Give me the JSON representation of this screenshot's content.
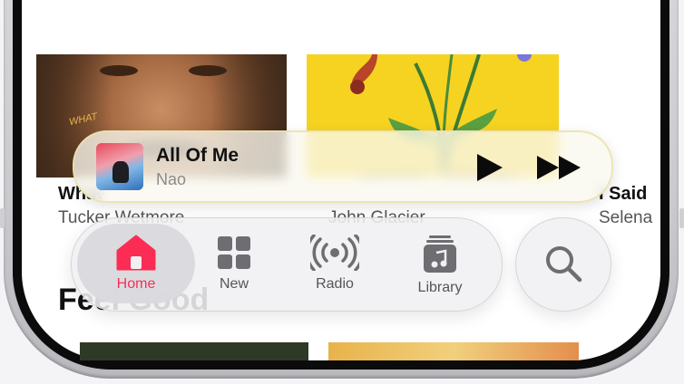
{
  "albums": [
    {
      "title": "What",
      "artist": "Tucker Wetmore"
    },
    {
      "title": "",
      "artist": "John Glacier"
    },
    {
      "title": "I Said",
      "artist": "Selena"
    }
  ],
  "art_caption": "WHAT",
  "now_playing": {
    "title": "All Of Me",
    "artist": "Nao"
  },
  "tabs": [
    {
      "label": "Home",
      "icon": "house-icon",
      "selected": true
    },
    {
      "label": "New",
      "icon": "grid-icon"
    },
    {
      "label": "Radio",
      "icon": "radio-icon"
    },
    {
      "label": "Library",
      "icon": "library-icon"
    }
  ],
  "search": {
    "icon": "search-icon"
  },
  "section_title": "Feel Good",
  "colors": {
    "accent": "#fb2d55",
    "icon_gray": "#6d6d72"
  }
}
